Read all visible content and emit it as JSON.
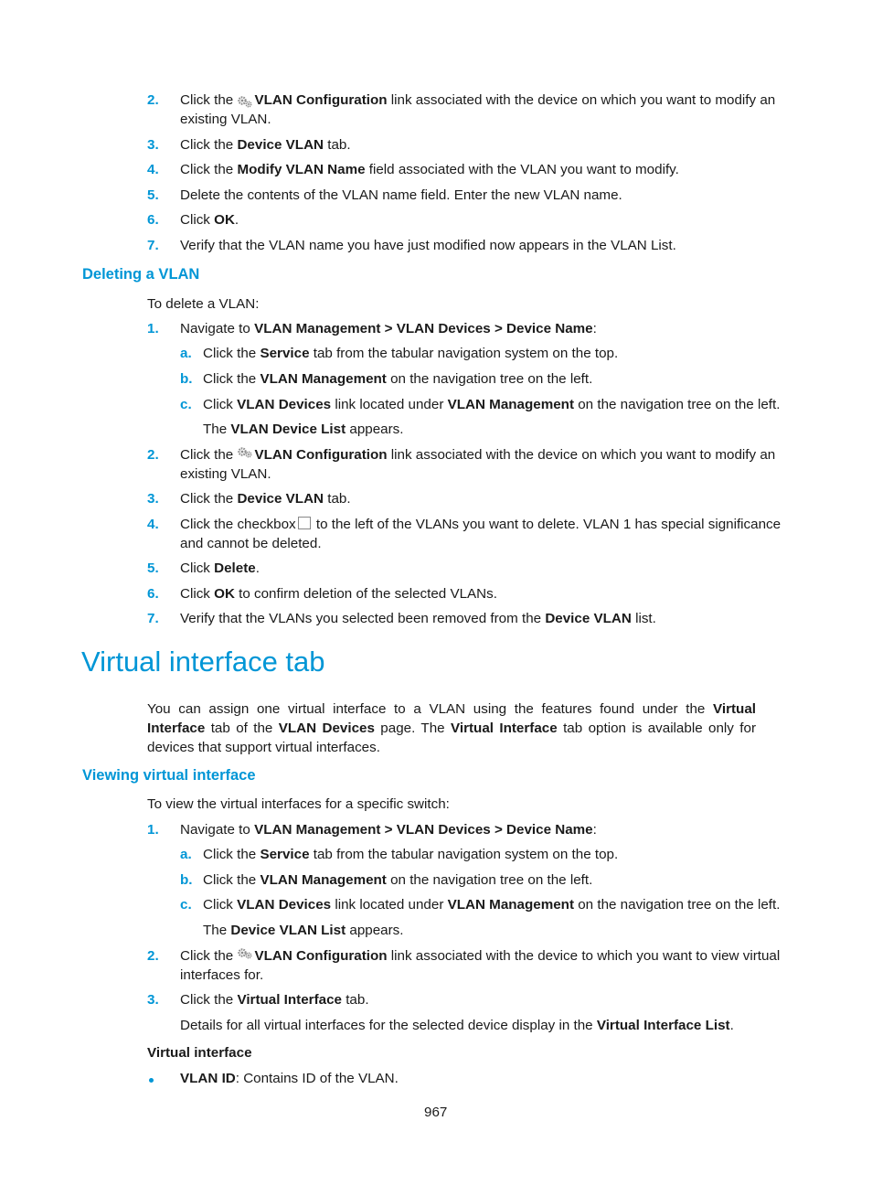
{
  "modify_steps": [
    {
      "num": "2.",
      "pre": "Click the ",
      "icon": "gear-icon",
      "bold": "VLAN Configuration",
      "post": " link associated with the device on which you want to modify an",
      "line2": "existing VLAN."
    },
    {
      "num": "3.",
      "pre": "Click the ",
      "bold": "Device VLAN",
      "post": " tab."
    },
    {
      "num": "4.",
      "pre": "Click the ",
      "bold": "Modify VLAN Name",
      "post": " field associated with the VLAN you want to modify."
    },
    {
      "num": "5.",
      "pre": "Delete the contents of the VLAN name field. Enter the new VLAN name."
    },
    {
      "num": "6.",
      "pre": "Click ",
      "bold": "OK",
      "post": "."
    },
    {
      "num": "7.",
      "pre": "Verify that the VLAN name you have just modified now appears in the VLAN List."
    }
  ],
  "deleting": {
    "heading": "Deleting a VLAN",
    "intro": "To delete a VLAN:",
    "step1": {
      "num": "1.",
      "pre": "Navigate to ",
      "bold": "VLAN Management > VLAN Devices > Device Name",
      "post": ":"
    },
    "substeps": [
      {
        "num": "a.",
        "pre": "Click the ",
        "bold": "Service",
        "post": " tab from the tabular navigation system on the top."
      },
      {
        "num": "b.",
        "pre": "Click the ",
        "bold": "VLAN Management",
        "post": " on the navigation tree on the left."
      },
      {
        "num": "c.",
        "pre": "Click ",
        "bold": "VLAN Devices",
        "mid": " link located under ",
        "bold2": "VLAN Management",
        "post": " on the navigation tree on the left."
      }
    ],
    "result": {
      "pre": "The ",
      "bold": "VLAN Device List",
      "post": " appears."
    },
    "step2": {
      "num": "2.",
      "pre": "Click the ",
      "bold": "VLAN Configuration",
      "post": " link associated with the device on which you want to modify an",
      "line2": "existing VLAN."
    },
    "step3": {
      "num": "3.",
      "pre": "Click the ",
      "bold": "Device VLAN",
      "post": " tab."
    },
    "step4": {
      "num": "4.",
      "pre": "Click the checkbox",
      "post": " to the left of the VLANs you want to delete. VLAN 1 has special significance",
      "line2": "and cannot be deleted."
    },
    "step5": {
      "num": "5.",
      "pre": "Click ",
      "bold": "Delete",
      "post": "."
    },
    "step6": {
      "num": "6.",
      "pre": "Click ",
      "bold": "OK",
      "post": " to confirm deletion of the selected VLANs."
    },
    "step7": {
      "num": "7.",
      "pre": "Verify that the VLANs you selected been removed from the ",
      "bold": "Device VLAN",
      "post": " list."
    }
  },
  "virtual": {
    "title": "Virtual interface tab",
    "para": {
      "p1": "You can assign one virtual interface to a VLAN using the features found under the ",
      "b1": "Virtual Interface",
      "p2": " tab of the ",
      "b2": "VLAN Devices",
      "p3": " page. The ",
      "b3": "Virtual Interface",
      "p4": " tab option is available only for devices that support virtual interfaces."
    },
    "viewing_heading": "Viewing virtual interface",
    "intro": "To view the virtual interfaces for a specific switch:",
    "step1": {
      "num": "1.",
      "pre": "Navigate to ",
      "bold": "VLAN Management > VLAN Devices > Device Name",
      "post": ":"
    },
    "substeps": [
      {
        "num": "a.",
        "pre": "Click the ",
        "bold": "Service",
        "post": " tab from the tabular navigation system on the top."
      },
      {
        "num": "b.",
        "pre": "Click the ",
        "bold": "VLAN Management",
        "post": " on the navigation tree on the left."
      },
      {
        "num": "c.",
        "pre": "Click ",
        "bold": "VLAN Devices",
        "mid": " link located under ",
        "bold2": "VLAN Management",
        "post": " on the navigation tree on the left."
      }
    ],
    "result": {
      "pre": "The ",
      "bold": "Device VLAN List",
      "post": " appears."
    },
    "step2": {
      "num": "2.",
      "pre": "Click the ",
      "bold": "VLAN Configuration",
      "post": " link associated with the device to which you want to view virtual",
      "line2": "interfaces for."
    },
    "step3": {
      "num": "3.",
      "pre": "Click the ",
      "bold": "Virtual Interface",
      "post": " tab."
    },
    "details": {
      "pre": "Details for all virtual interfaces for the selected device display in the ",
      "bold": "Virtual Interface List",
      "post": "."
    },
    "subheading": "Virtual interface",
    "bullet": {
      "bold": "VLAN ID",
      "post": ": Contains ID of the VLAN."
    }
  },
  "page_number": "967",
  "colors": {
    "accent": "#0096d6",
    "text": "#1a1a1a"
  }
}
